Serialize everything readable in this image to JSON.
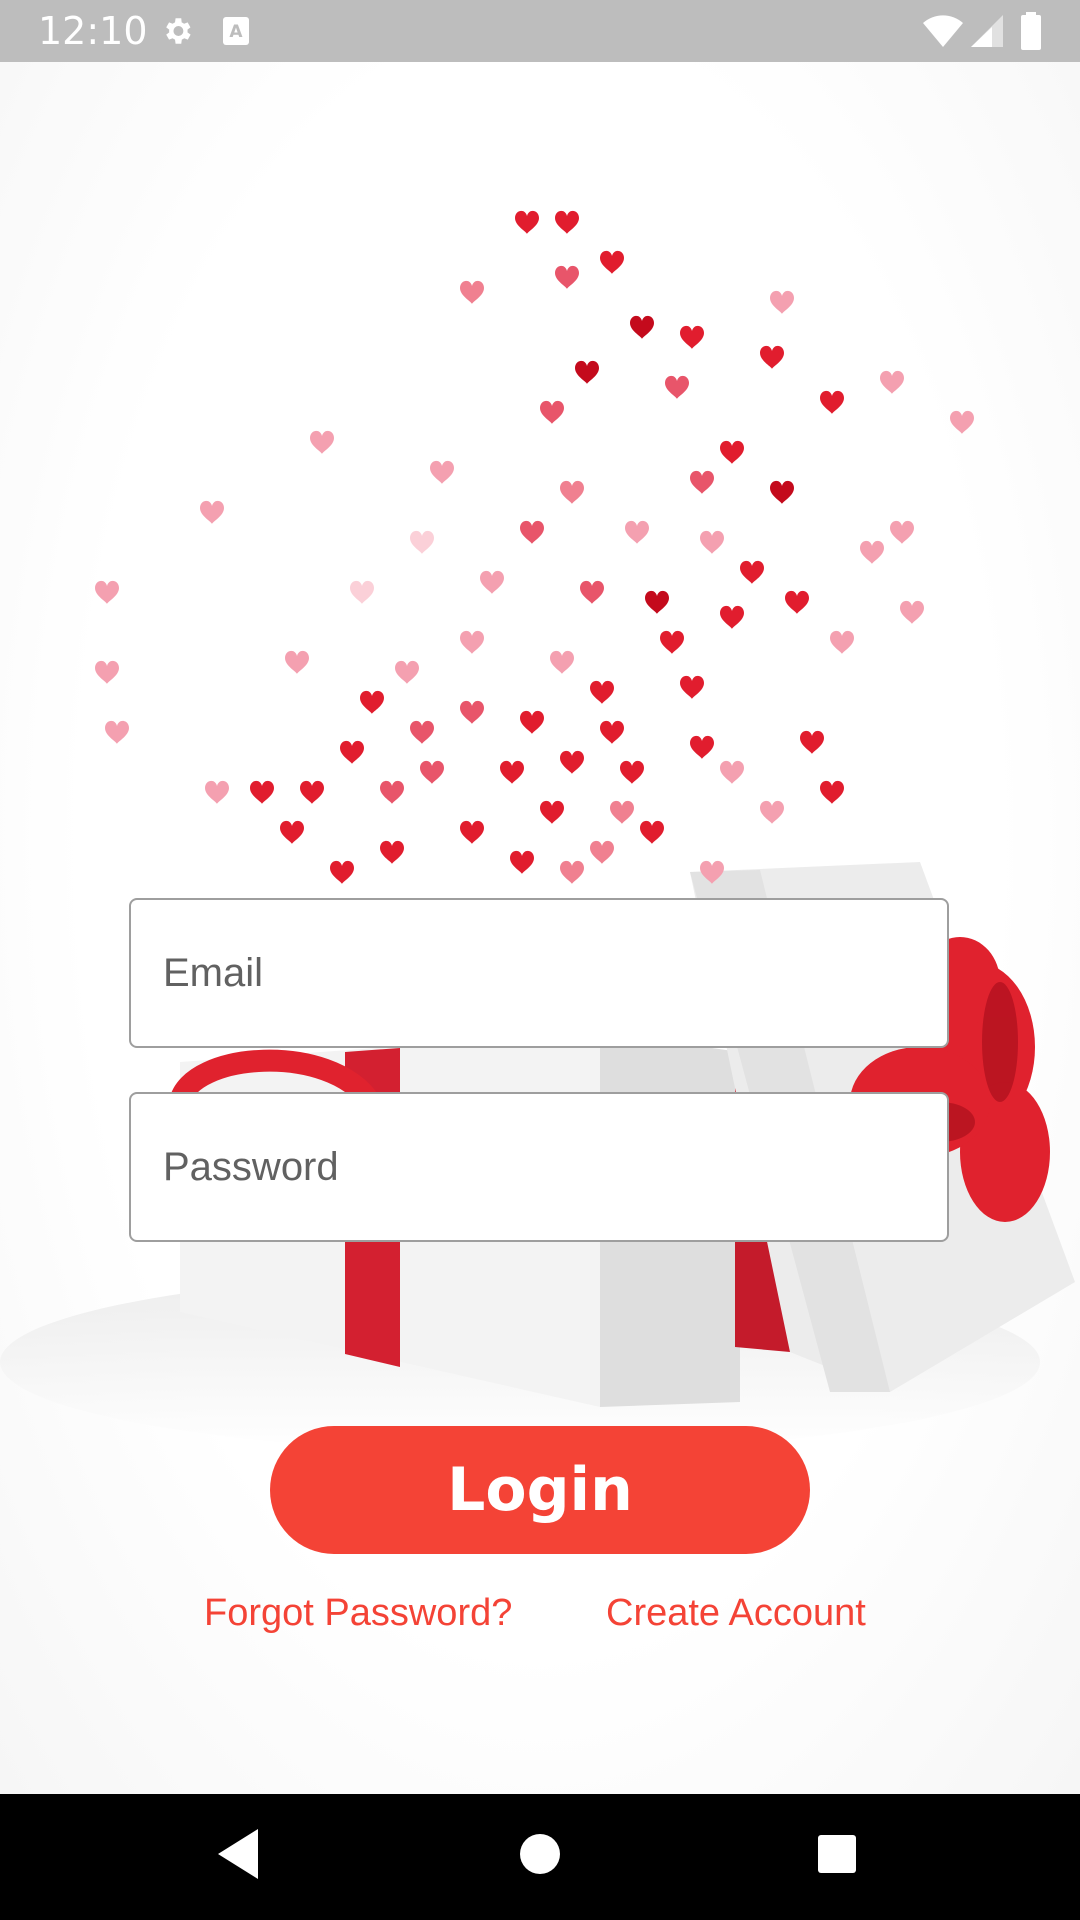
{
  "status_bar": {
    "time": "12:10",
    "icons": [
      "gear-icon",
      "a-notification-icon",
      "wifi-icon",
      "signal-icon",
      "battery-icon"
    ]
  },
  "login": {
    "email_placeholder": "Email",
    "password_placeholder": "Password",
    "login_label": "Login",
    "forgot_password": "Forgot Password?",
    "create_account": "Create Account"
  },
  "colors": {
    "accent": "#f44336",
    "status_bar": "#bdbdbd",
    "nav_bar": "#000000"
  },
  "nav_bar": {
    "icons": [
      "back-icon",
      "home-icon",
      "recents-icon"
    ]
  }
}
